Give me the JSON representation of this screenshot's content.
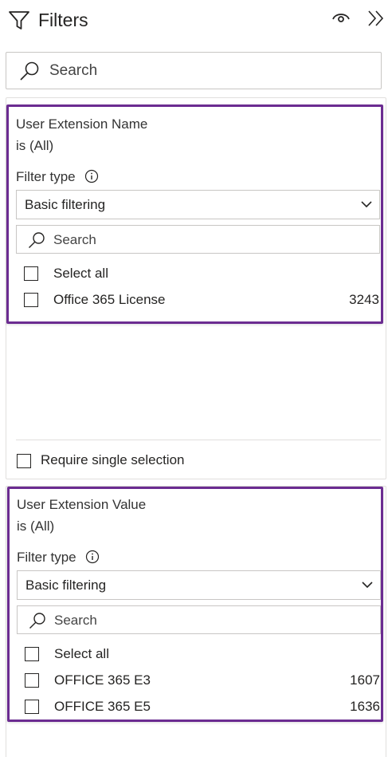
{
  "header": {
    "title": "Filters",
    "icons": [
      "filter-funnel-icon",
      "eye-icon",
      "double-chevron-right-icon"
    ]
  },
  "pane_search": {
    "placeholder": "Search"
  },
  "cards": [
    {
      "title": "User Extension Name",
      "summary": "is (All)",
      "filter_type_label": "Filter type",
      "filter_type_value": "Basic filtering",
      "search_placeholder": "Search",
      "select_all_label": "Select all",
      "items": [
        {
          "label": "Office 365 License",
          "count": "3243"
        }
      ],
      "require_single_selection_label": "Require single selection"
    },
    {
      "title": "User Extension Value",
      "summary": "is (All)",
      "filter_type_label": "Filter type",
      "filter_type_value": "Basic filtering",
      "search_placeholder": "Search",
      "select_all_label": "Select all",
      "items": [
        {
          "label": "OFFICE 365 E3",
          "count": "1607"
        },
        {
          "label": "OFFICE 365 E5",
          "count": "1636"
        }
      ]
    }
  ],
  "colors": {
    "highlight_border": "#6b2c91",
    "border": "#c8c6c4",
    "text": "#252423"
  }
}
